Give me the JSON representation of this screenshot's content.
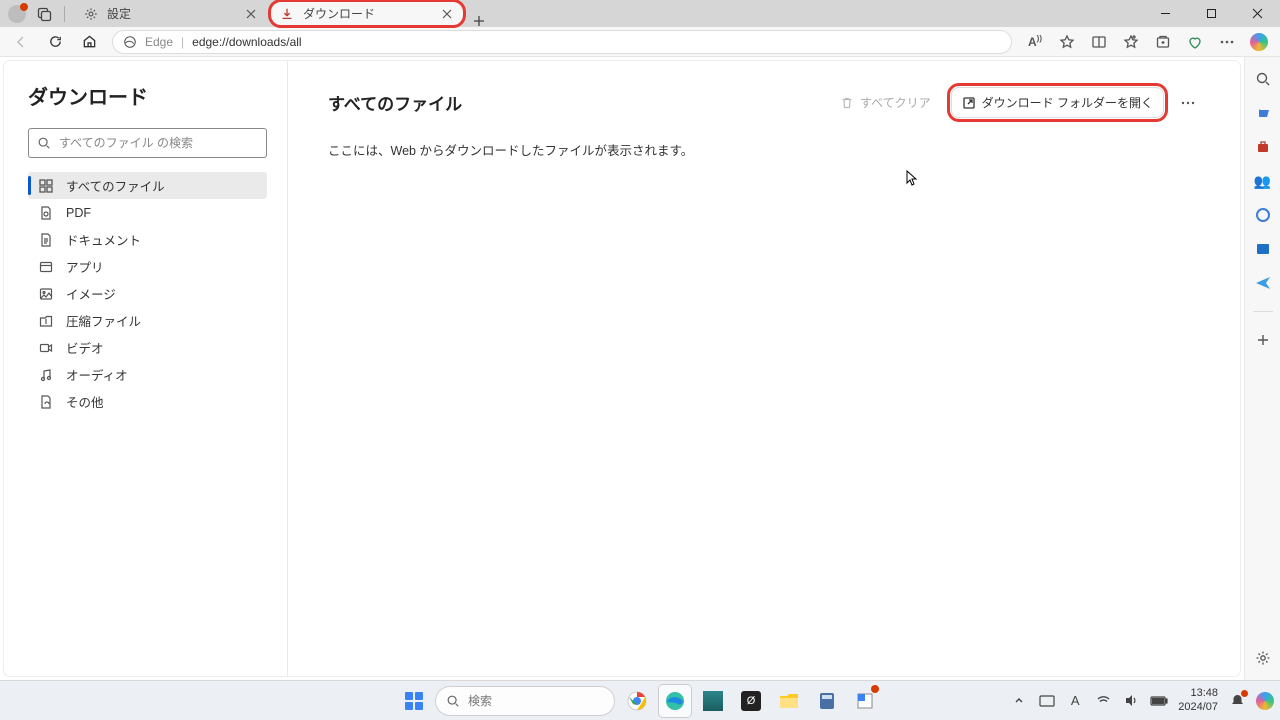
{
  "tabs": [
    {
      "icon": "settings",
      "label": "設定"
    },
    {
      "icon": "download",
      "label": "ダウンロード"
    }
  ],
  "address": {
    "brand": "Edge",
    "url": "edge://downloads/all"
  },
  "page": {
    "title": "ダウンロード",
    "search_placeholder": "すべてのファイル の検索",
    "nav": [
      {
        "icon": "grid",
        "label": "すべてのファイル"
      },
      {
        "icon": "pdf",
        "label": "PDF"
      },
      {
        "icon": "doc",
        "label": "ドキュメント"
      },
      {
        "icon": "app",
        "label": "アプリ"
      },
      {
        "icon": "image",
        "label": "イメージ"
      },
      {
        "icon": "zip",
        "label": "圧縮ファイル"
      },
      {
        "icon": "video",
        "label": "ビデオ"
      },
      {
        "icon": "audio",
        "label": "オーディオ"
      },
      {
        "icon": "other",
        "label": "その他"
      }
    ],
    "main": {
      "heading": "すべてのファイル",
      "clear_all": "すべてクリア",
      "open_folder": "ダウンロード フォルダーを開く",
      "empty_message": "ここには、Web からダウンロードしたファイルが表示されます。"
    }
  },
  "taskbar": {
    "search_placeholder": "検索",
    "time": "13:48",
    "date": "2024/07"
  }
}
